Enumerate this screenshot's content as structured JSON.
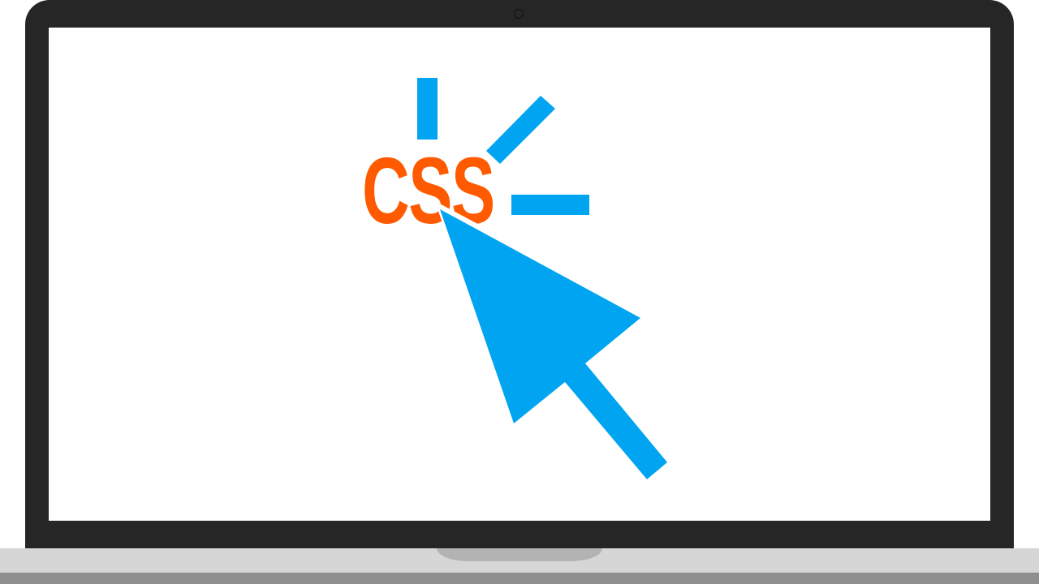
{
  "illustration": {
    "logo_text": "CSS",
    "colors": {
      "laptop_frame": "#262626",
      "screen": "#ffffff",
      "laptop_base": "#d6d6d6",
      "base_shadow": "#8f8f8f",
      "hinge": "#b3b3b3",
      "logo_text": "#ff5a00",
      "cursor": "#00a4f0"
    },
    "icons": [
      "laptop-icon",
      "camera-icon",
      "mouse-pointer-icon",
      "click-burst-icon"
    ]
  }
}
